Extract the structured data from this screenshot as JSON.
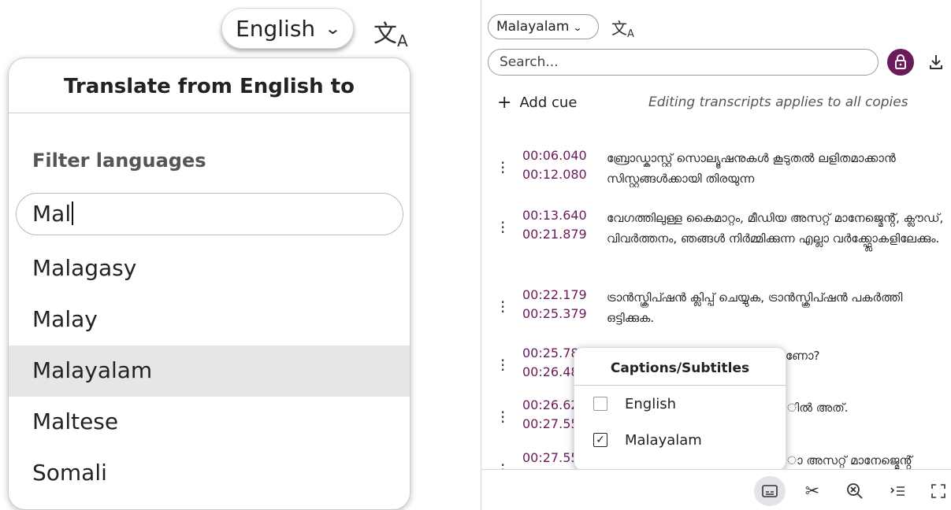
{
  "left": {
    "language_button": "English",
    "panel_title": "Translate from English to",
    "filter_label": "Filter languages",
    "filter_value": "Mal",
    "languages": [
      "Malagasy",
      "Malay",
      "Malayalam",
      "Maltese",
      "Somali"
    ],
    "selected_language": "Malayalam"
  },
  "right": {
    "language_select": "Malayalam",
    "search_placeholder": "Search...",
    "add_cue_label": "Add cue",
    "edit_note": "Editing transcripts applies to all copies",
    "cues": [
      {
        "start": "00:06.040",
        "end": "00:12.080",
        "text": "ബ്രോഡ്കാസ്റ്റ് സൊല്യൂഷനുകൾ കൂടുതൽ ലളിതമാക്കാൻ സിസ്റ്റങ്ങൾക്കായി തിരയുന്ന"
      },
      {
        "start": "00:13.640",
        "end": "00:21.879",
        "text": "വേഗത്തിലുള്ള കൈമാറ്റം, മീഡിയ അസറ്റ് മാനേജ്മെൻ്റ്, ക്ലൗഡ്, വിവർത്തനം, ഞങ്ങൾ നിർമ്മിക്കുന്ന എല്ലാ വർക്ക്ഫ്ലോകളിലേക്കും."
      },
      {
        "start": "00:22.179",
        "end": "00:25.379",
        "text": "ട്രാൻസ്ക്രിപ്ഷൻ ക്ലിപ്പ് ചെയ്യുക, ട്രാൻസ്ക്രിപ്ഷൻ പകർത്തി ഒട്ടിക്കുക."
      },
      {
        "start": "00:25.780",
        "end": "00:26.48",
        "text": "ണോ?"
      },
      {
        "start": "00:26.62",
        "end": "00:27.55",
        "text": "ിൽ അത്."
      },
      {
        "start": "00:27.55",
        "end": "",
        "text": "ാ അസറ്റ് മാനേജ്മെൻ്റ്"
      }
    ],
    "captions_popup": {
      "title": "Captions/Subtitles",
      "options": [
        {
          "label": "English",
          "checked": false
        },
        {
          "label": "Malayalam",
          "checked": true
        }
      ]
    }
  },
  "colors": {
    "accent": "#6b1a5b",
    "selected_row": "#e6e6e9"
  },
  "icons": [
    "translate-icon",
    "lock-icon",
    "download-icon",
    "captions-icon",
    "scissors-icon",
    "zoom-icon",
    "indent-icon",
    "fullscreen-icon"
  ]
}
